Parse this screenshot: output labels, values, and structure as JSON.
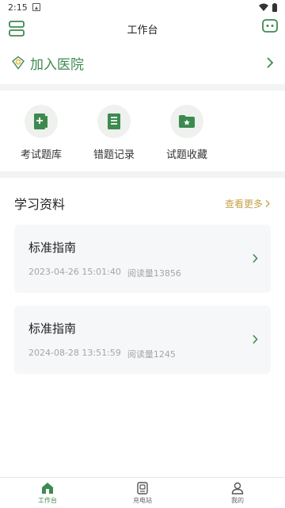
{
  "status_bar": {
    "time": "2:15"
  },
  "header": {
    "title": "工作台"
  },
  "join": {
    "label": "加入医院"
  },
  "shortcuts": [
    {
      "label": "考试题库",
      "icon": "exam-bank-icon"
    },
    {
      "label": "错题记录",
      "icon": "wrong-record-icon"
    },
    {
      "label": "试题收藏",
      "icon": "favorite-folder-icon"
    }
  ],
  "materials": {
    "title": "学习资料",
    "more_label": "查看更多",
    "items": [
      {
        "title": "标准指南",
        "date": "2023-04-26 15:01:40",
        "reads": "阅读量13856"
      },
      {
        "title": "标准指南",
        "date": "2024-08-28 13:51:59",
        "reads": "阅读量1245"
      }
    ]
  },
  "bottom_nav": [
    {
      "label": "工作台",
      "icon": "home-icon",
      "active": true
    },
    {
      "label": "充电站",
      "icon": "charging-station-icon",
      "active": false
    },
    {
      "label": "我的",
      "icon": "profile-icon",
      "active": false
    }
  ],
  "colors": {
    "accent": "#3d8a50",
    "more": "#c6a24a",
    "card_bg": "#f6f7f8",
    "divider": "#f2f3f5"
  }
}
